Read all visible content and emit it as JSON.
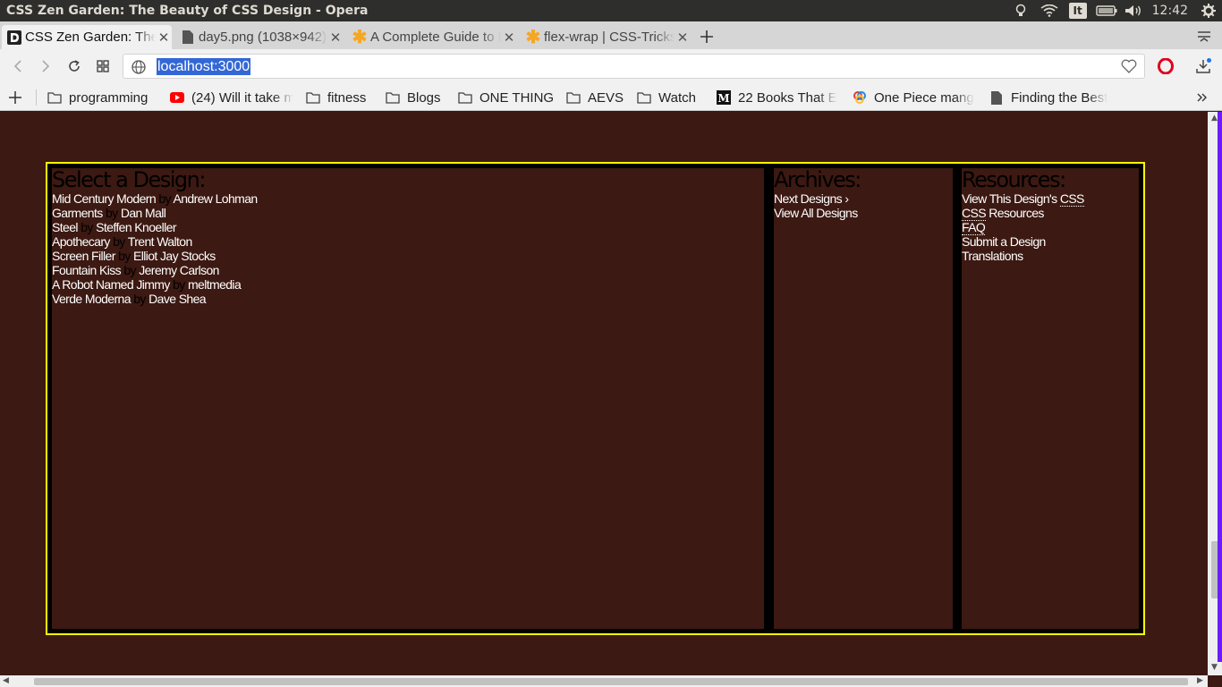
{
  "os": {
    "window_title": "CSS Zen Garden: The Beauty of CSS Design - Opera",
    "keyboard_layout": "It",
    "time": "12:42"
  },
  "tabs": [
    {
      "title": "CSS Zen Garden: The Beauty of CSS Design",
      "active": true
    },
    {
      "title": "day5.png (1038×942)",
      "active": false
    },
    {
      "title": "A Complete Guide to Flexbox",
      "active": false
    },
    {
      "title": "flex-wrap | CSS-Tricks",
      "active": false
    }
  ],
  "toolbar": {
    "url": "localhost:3000"
  },
  "bookmarks": [
    {
      "label": "programming",
      "icon": "folder-icon"
    },
    {
      "label": "(24) Will it take m",
      "icon": "youtube-icon"
    },
    {
      "label": "fitness",
      "icon": "folder-icon"
    },
    {
      "label": "Blogs",
      "icon": "folder-icon"
    },
    {
      "label": "ONE THING",
      "icon": "folder-icon"
    },
    {
      "label": "AEVS",
      "icon": "folder-icon"
    },
    {
      "label": "Watch",
      "icon": "folder-icon"
    },
    {
      "label": "22 Books That E",
      "icon": "medium-icon"
    },
    {
      "label": "One Piece mang",
      "icon": "colorful-icon"
    },
    {
      "label": "Finding the Best",
      "icon": "page-icon"
    }
  ],
  "page": {
    "select_design": {
      "heading": "Select a Design:",
      "by_word": "by",
      "designs": [
        {
          "name": "Mid Century Modern",
          "author": "Andrew Lohman"
        },
        {
          "name": "Garments",
          "author": "Dan Mall"
        },
        {
          "name": "Steel",
          "author": "Steffen Knoeller"
        },
        {
          "name": "Apothecary",
          "author": "Trent Walton"
        },
        {
          "name": "Screen Filler",
          "author": "Elliot Jay Stocks"
        },
        {
          "name": "Fountain Kiss",
          "author": "Jeremy Carlson"
        },
        {
          "name": "A Robot Named Jimmy",
          "author": "meltmedia"
        },
        {
          "name": "Verde Moderna",
          "author": "Dave Shea"
        }
      ]
    },
    "archives": {
      "heading": "Archives:",
      "links": [
        "Next Designs ›",
        "View All Designs"
      ]
    },
    "resources": {
      "heading": "Resources:",
      "view_prefix": "View This Design's ",
      "view_abbr": "CSS",
      "css_abbr": "CSS",
      "css_suffix": " Resources",
      "faq": "FAQ",
      "submit": "Submit a Design",
      "translations": "Translations"
    }
  },
  "colors": {
    "page_bg": "#3c1912",
    "border": "#ffff00",
    "link": "#ffffff"
  }
}
